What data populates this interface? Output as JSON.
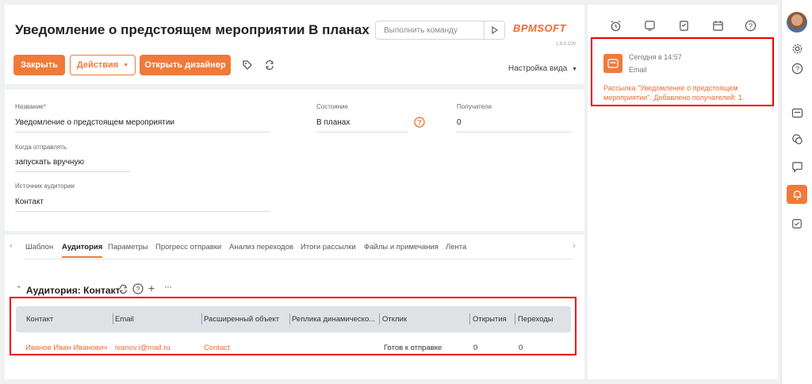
{
  "header": {
    "title": "Уведомление о предстоящем мероприятии В планах",
    "command_placeholder": "Выполнить команду",
    "logo": "BPMSOFT",
    "version": "1.8.0.100",
    "close_label": "Закрыть",
    "actions_label": "Действия",
    "designer_label": "Открыть дизайнер",
    "view_settings_label": "Настройка вида"
  },
  "form": {
    "name_label": "Название",
    "name_value": "Уведомление о предстоящем мероприятии",
    "state_label": "Состояние",
    "state_value": "В планах",
    "recipients_label": "Получатели",
    "recipients_value": "0",
    "send_when_label": "Когда отправлять",
    "send_when_value": "запускать вручную",
    "audience_source_label": "Источник аудитории",
    "audience_source_value": "Контакт"
  },
  "tabs": [
    "Шаблон",
    "Аудитория",
    "Параметры",
    "Прогресс отправки",
    "Анализ переходов",
    "Итоги рассылки",
    "Файлы и примечания",
    "Лента"
  ],
  "audience": {
    "title": "Аудитория: Контакт",
    "columns": [
      "Контакт",
      "Email",
      "Расширенный объект",
      "Реплика динамическо...",
      "Отклик",
      "Открытия",
      "Переходы"
    ],
    "rows": [
      {
        "contact": "Иванов Иван Иванович",
        "email": "ivanov.i@mail.ru",
        "object": "Contact",
        "replica": "",
        "response": "Готов к отправке",
        "opens": "0",
        "clicks": "0"
      }
    ]
  },
  "notification": {
    "time": "Сегодня в 14:57",
    "type": "Email",
    "text": "Рассылка \"Уведомление о предстоящем мероприятии\". Добавлено получателей: 1."
  },
  "colors": {
    "accent": "#f07a3a",
    "highlight": "#e00000"
  }
}
